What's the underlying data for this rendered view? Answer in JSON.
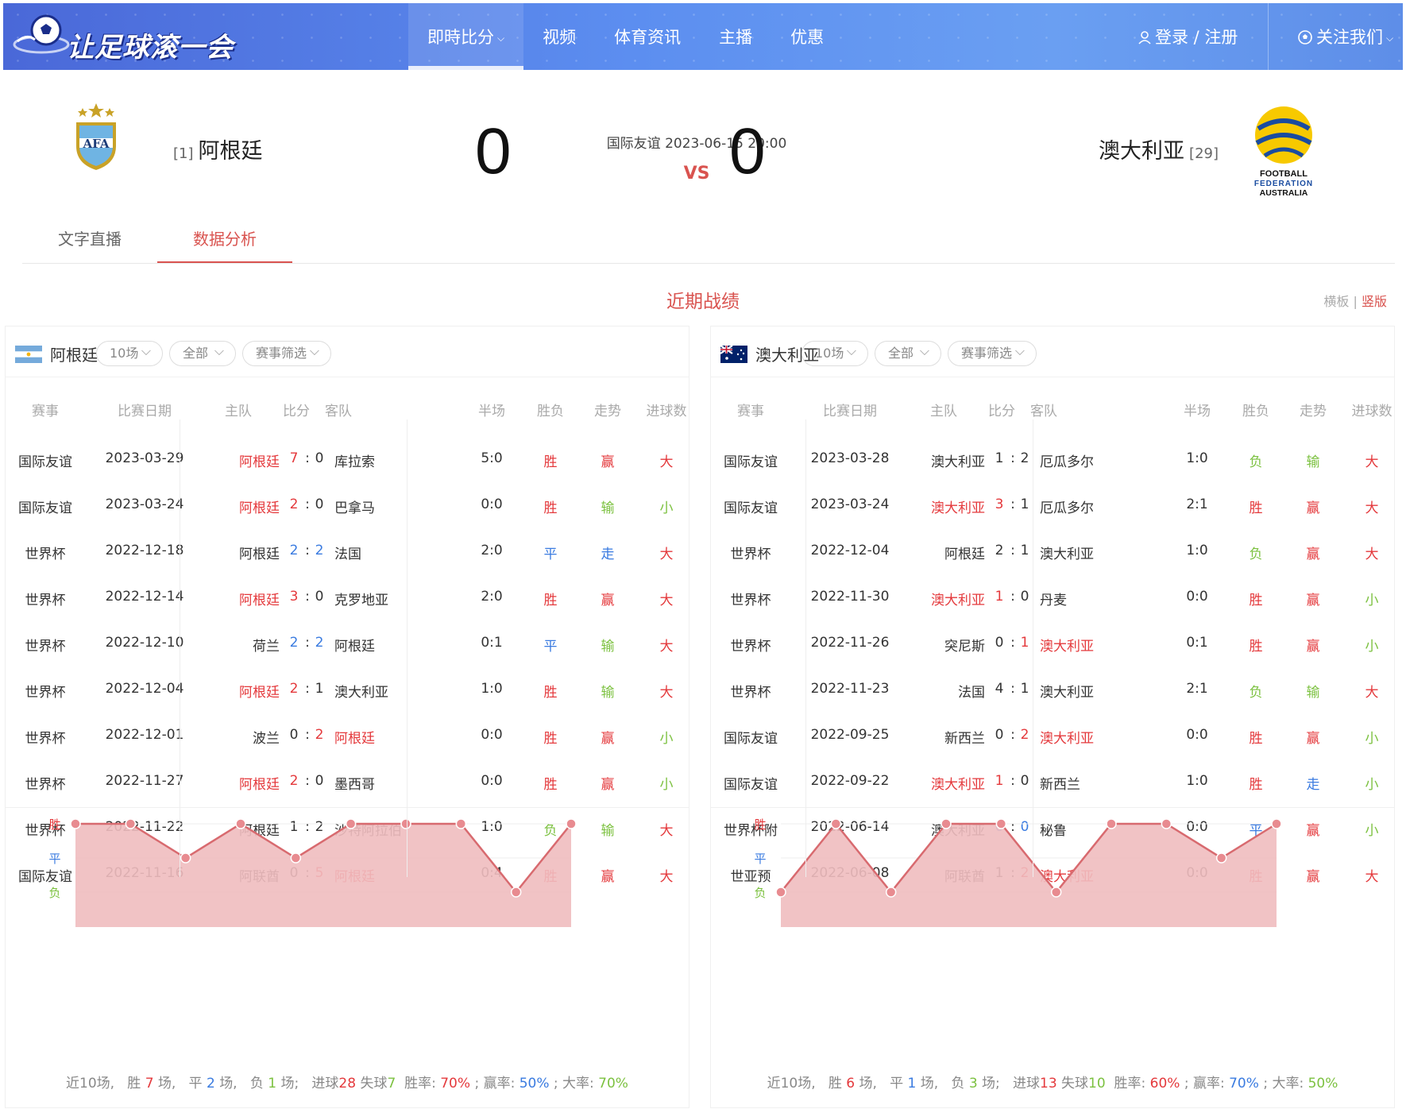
{
  "brand": {
    "logo_text": "让足球滚一会"
  },
  "nav": {
    "items": [
      {
        "label": "即時比分",
        "active": true,
        "dropdown": true
      },
      {
        "label": "视频"
      },
      {
        "label": "体育资讯"
      },
      {
        "label": "主播"
      },
      {
        "label": "优惠"
      }
    ],
    "login": "登录 / 注册",
    "follow": "关注我们"
  },
  "match": {
    "home": {
      "name": "阿根廷",
      "rank": "[1]",
      "score": "0",
      "badge": "AFA"
    },
    "away": {
      "name": "澳大利亚",
      "rank": "[29]",
      "score": "0",
      "badge_lines": [
        "FOOTBALL",
        "FEDERATION",
        "AUSTRALIA"
      ]
    },
    "info": "国际友谊 2023-06-15 20:00",
    "vs": "VS"
  },
  "tabs": [
    {
      "label": "文字直播",
      "active": false
    },
    {
      "label": "数据分析",
      "active": true
    }
  ],
  "section": {
    "title": "近期战绩",
    "layout_h": "横板",
    "layout_sep": "|",
    "layout_v": "竖版"
  },
  "columns": [
    "赛事",
    "比赛日期",
    "主队",
    "比分",
    "客队",
    "半场",
    "胜负",
    "走势",
    "进球数"
  ],
  "panels": [
    {
      "team": "阿根廷",
      "filters": [
        "10场",
        "全部",
        "赛事筛选"
      ],
      "rows": [
        {
          "comp": "国际友谊",
          "date": "2023-03-29",
          "home": "阿根廷",
          "hs": "7",
          "as": "0",
          "away": "库拉索",
          "half": "5:0",
          "wl": "胜",
          "tr": "赢",
          "ou": "大",
          "hl": "home"
        },
        {
          "comp": "国际友谊",
          "date": "2023-03-24",
          "home": "阿根廷",
          "hs": "2",
          "as": "0",
          "away": "巴拿马",
          "half": "0:0",
          "wl": "胜",
          "tr": "输",
          "ou": "小",
          "hl": "home"
        },
        {
          "comp": "世界杯",
          "date": "2022-12-18",
          "home": "阿根廷",
          "hs": "2",
          "as": "2",
          "away": "法国",
          "half": "2:0",
          "wl": "平",
          "tr": "走",
          "ou": "大",
          "hl": "draw"
        },
        {
          "comp": "世界杯",
          "date": "2022-12-14",
          "home": "阿根廷",
          "hs": "3",
          "as": "0",
          "away": "克罗地亚",
          "half": "2:0",
          "wl": "胜",
          "tr": "赢",
          "ou": "大",
          "hl": "home"
        },
        {
          "comp": "世界杯",
          "date": "2022-12-10",
          "home": "荷兰",
          "hs": "2",
          "as": "2",
          "away": "阿根廷",
          "half": "0:1",
          "wl": "平",
          "tr": "输",
          "ou": "大",
          "hl": "draw"
        },
        {
          "comp": "世界杯",
          "date": "2022-12-04",
          "home": "阿根廷",
          "hs": "2",
          "as": "1",
          "away": "澳大利亚",
          "half": "1:0",
          "wl": "胜",
          "tr": "输",
          "ou": "大",
          "hl": "home"
        },
        {
          "comp": "世界杯",
          "date": "2022-12-01",
          "home": "波兰",
          "hs": "0",
          "as": "2",
          "away": "阿根廷",
          "half": "0:0",
          "wl": "胜",
          "tr": "赢",
          "ou": "小",
          "hl": "away"
        },
        {
          "comp": "世界杯",
          "date": "2022-11-27",
          "home": "阿根廷",
          "hs": "2",
          "as": "0",
          "away": "墨西哥",
          "half": "0:0",
          "wl": "胜",
          "tr": "赢",
          "ou": "小",
          "hl": "home"
        },
        {
          "comp": "世界杯",
          "date": "2022-11-22",
          "home": "阿根廷",
          "hs": "1",
          "as": "2",
          "away": "沙特阿拉伯",
          "half": "1:0",
          "wl": "负",
          "tr": "输",
          "ou": "大",
          "hl": "none"
        },
        {
          "comp": "国际友谊",
          "date": "2022-11-16",
          "home": "阿联酋",
          "hs": "0",
          "as": "5",
          "away": "阿根廷",
          "half": "0:4",
          "wl": "胜",
          "tr": "赢",
          "ou": "大",
          "hl": "away"
        }
      ],
      "chart": {
        "labels": [
          "胜",
          "平",
          "负"
        ],
        "results": [
          "胜",
          "胜",
          "平",
          "胜",
          "平",
          "胜",
          "胜",
          "胜",
          "负",
          "胜"
        ]
      },
      "summary": {
        "prefix": "近10场,",
        "w_label": "胜",
        "w": "7",
        "w_unit": "场,",
        "d_label": "平",
        "d": "2",
        "d_unit": "场,",
        "l_label": "负",
        "l": "1",
        "l_unit": "场;",
        "gf_label": "进球",
        "gf": "28",
        "ga_label": "失球",
        "ga": "7",
        "wr_label": "胜率:",
        "wr": "70%",
        "win_label": "; 赢率:",
        "win": "50%",
        "big_label": "; 大率:",
        "big": "70%"
      }
    },
    {
      "team": "澳大利亚",
      "filters": [
        "10场",
        "全部",
        "赛事筛选"
      ],
      "rows": [
        {
          "comp": "国际友谊",
          "date": "2023-03-28",
          "home": "澳大利亚",
          "hs": "1",
          "as": "2",
          "away": "厄瓜多尔",
          "half": "1:0",
          "wl": "负",
          "tr": "输",
          "ou": "大",
          "hl": "none"
        },
        {
          "comp": "国际友谊",
          "date": "2023-03-24",
          "home": "澳大利亚",
          "hs": "3",
          "as": "1",
          "away": "厄瓜多尔",
          "half": "2:1",
          "wl": "胜",
          "tr": "赢",
          "ou": "大",
          "hl": "home"
        },
        {
          "comp": "世界杯",
          "date": "2022-12-04",
          "home": "阿根廷",
          "hs": "2",
          "as": "1",
          "away": "澳大利亚",
          "half": "1:0",
          "wl": "负",
          "tr": "赢",
          "ou": "大",
          "hl": "none"
        },
        {
          "comp": "世界杯",
          "date": "2022-11-30",
          "home": "澳大利亚",
          "hs": "1",
          "as": "0",
          "away": "丹麦",
          "half": "0:0",
          "wl": "胜",
          "tr": "赢",
          "ou": "小",
          "hl": "home"
        },
        {
          "comp": "世界杯",
          "date": "2022-11-26",
          "home": "突尼斯",
          "hs": "0",
          "as": "1",
          "away": "澳大利亚",
          "half": "0:1",
          "wl": "胜",
          "tr": "赢",
          "ou": "小",
          "hl": "away"
        },
        {
          "comp": "世界杯",
          "date": "2022-11-23",
          "home": "法国",
          "hs": "4",
          "as": "1",
          "away": "澳大利亚",
          "half": "2:1",
          "wl": "负",
          "tr": "输",
          "ou": "大",
          "hl": "none"
        },
        {
          "comp": "国际友谊",
          "date": "2022-09-25",
          "home": "新西兰",
          "hs": "0",
          "as": "2",
          "away": "澳大利亚",
          "half": "0:0",
          "wl": "胜",
          "tr": "赢",
          "ou": "小",
          "hl": "away"
        },
        {
          "comp": "国际友谊",
          "date": "2022-09-22",
          "home": "澳大利亚",
          "hs": "1",
          "as": "0",
          "away": "新西兰",
          "half": "1:0",
          "wl": "胜",
          "tr": "走",
          "ou": "小",
          "hl": "home"
        },
        {
          "comp": "世界杯附",
          "date": "2022-06-14",
          "home": "澳大利亚",
          "hs": "0",
          "as": "0",
          "away": "秘鲁",
          "half": "0:0",
          "wl": "平",
          "tr": "赢",
          "ou": "小",
          "hl": "draw"
        },
        {
          "comp": "世亚预",
          "date": "2022-06-08",
          "home": "阿联酋",
          "hs": "1",
          "as": "2",
          "away": "澳大利亚",
          "half": "0:0",
          "wl": "胜",
          "tr": "赢",
          "ou": "大",
          "hl": "away"
        }
      ],
      "chart": {
        "labels": [
          "胜",
          "平",
          "负"
        ],
        "results": [
          "负",
          "胜",
          "负",
          "胜",
          "胜",
          "负",
          "胜",
          "胜",
          "平",
          "胜"
        ]
      },
      "summary": {
        "prefix": "近10场,",
        "w_label": "胜",
        "w": "6",
        "w_unit": "场,",
        "d_label": "平",
        "d": "1",
        "d_unit": "场,",
        "l_label": "负",
        "l": "3",
        "l_unit": "场;",
        "gf_label": "进球",
        "gf": "13",
        "ga_label": "失球",
        "ga": "10",
        "wr_label": "胜率:",
        "wr": "60%",
        "win_label": "; 赢率:",
        "win": "70%",
        "big_label": "; 大率:",
        "big": "50%"
      }
    }
  ],
  "colors": {
    "accent": "#e4393c",
    "draw": "#3a7be0",
    "loss": "#7cc140",
    "chart_fill": "#efbcbf",
    "chart_line": "#d86a6f"
  }
}
